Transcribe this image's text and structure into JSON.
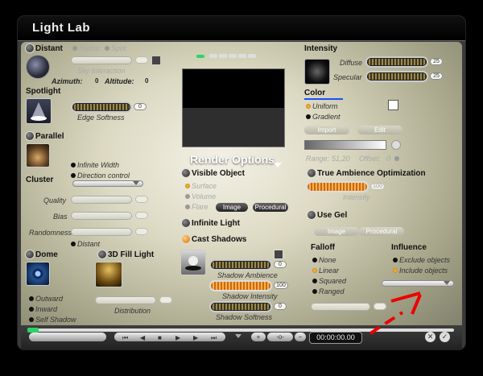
{
  "title": "Light Lab",
  "distant": {
    "label": "Distant",
    "radial": "Radial",
    "spot": "Spot",
    "sky": "Sky Interaction",
    "azimuth_label": "Azimuth:",
    "azimuth": "0",
    "altitude_label": "Altitude:",
    "altitude": "0"
  },
  "spotlight": {
    "label": "Spotlight",
    "edge": "Edge Softness",
    "value": "0"
  },
  "parallel": {
    "label": "Parallel",
    "infinite_width": "Infinite Width",
    "direction": "Direction control"
  },
  "cluster": {
    "label": "Cluster",
    "quality": "Quality",
    "bias": "Bias",
    "randomness": "Randomness",
    "distant": "Distant"
  },
  "dome": {
    "label": "Dome",
    "outward": "Outward",
    "inward": "Inward",
    "self_shadow": "Self Shadow"
  },
  "fill": {
    "label": "3D Fill Light",
    "distribution": "Distribution"
  },
  "render": {
    "title": "Render Options",
    "visible": "Visible Object",
    "surface": "Surface",
    "volume": "Volume",
    "flare": "Flare",
    "image": "Image",
    "procedural": "Procedural",
    "infinite": "Infinite Light",
    "cast": "Cast Shadows",
    "ambience": "Shadow Ambience",
    "ambience_val": "0",
    "intensity": "Shadow Intensity",
    "intensity_val": "100",
    "softness": "Shadow Softness",
    "softness_val": "0"
  },
  "intensity": {
    "label": "Intensity",
    "diffuse": "Diffuse",
    "diffuse_val": "25",
    "specular": "Specular",
    "specular_val": "25"
  },
  "color": {
    "label": "Color",
    "uniform": "Uniform",
    "gradient": "Gradient",
    "import": "Import",
    "edit": "Edit",
    "range_label": "Range:",
    "range": "51,20",
    "offset_label": "Offset:",
    "offset": "0",
    "accent": "#1a4dff"
  },
  "tao": {
    "label": "True Ambience Optimization",
    "intensity": "Intensity",
    "value": "100"
  },
  "gel": {
    "label": "Use Gel",
    "image": "Image",
    "procedural": "Procedural"
  },
  "falloff": {
    "label": "Falloff",
    "none": "None",
    "linear": "Linear",
    "squared": "Squared",
    "ranged": "Ranged"
  },
  "influence": {
    "label": "Influence",
    "exclude": "Exclude objects",
    "include": "Include objects"
  },
  "timeline": {
    "time": "00:00:00.00"
  }
}
